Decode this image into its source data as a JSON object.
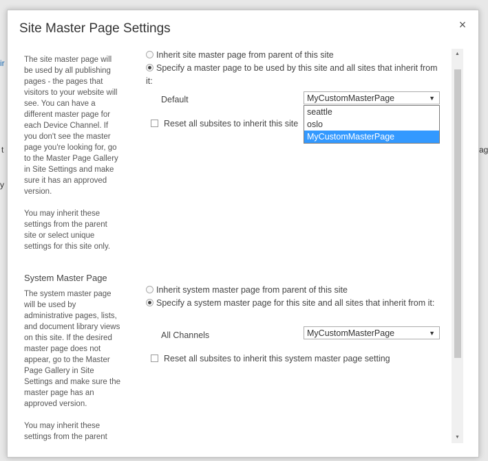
{
  "background": {
    "fragments": [
      "ir",
      "t",
      "y",
      "ag"
    ]
  },
  "dialog": {
    "title": "Site Master Page Settings",
    "close_icon": "×"
  },
  "site_master": {
    "description": [
      "The site master page will be used by all publishing pages - the pages that visitors to your website will see. You can have a different master page for each Device Channel. If you don't see the master page you're looking for, go to the Master Page Gallery in Site Settings and make sure it has an approved version.",
      "You may inherit these settings from the parent site or select unique settings for this site only."
    ],
    "option_inherit": "Inherit site master page from parent of this site",
    "option_specify": "Specify a master page to be used by this site and all sites that inherit from it:",
    "channel_label": "Default",
    "selected_value": "MyCustomMasterPage",
    "dropdown_options": [
      "seattle",
      "oslo",
      "MyCustomMasterPage"
    ],
    "reset_label": "Reset all subsites to inherit this site"
  },
  "system_master": {
    "title": "System Master Page",
    "description": [
      "The system master page will be used by administrative pages, lists, and document library views on this site. If the desired master page does not appear, go to the Master Page Gallery in Site Settings and make sure the master page has an approved version.",
      "You may inherit these settings from the parent"
    ],
    "option_inherit": "Inherit system master page from parent of this site",
    "option_specify": "Specify a system master page for this site and all sites that inherit from it:",
    "channel_label": "All Channels",
    "selected_value": "MyCustomMasterPage",
    "reset_label": "Reset all subsites to inherit this system master page setting"
  },
  "scrollbar": {
    "up_icon": "▲",
    "down_icon": "▼"
  }
}
